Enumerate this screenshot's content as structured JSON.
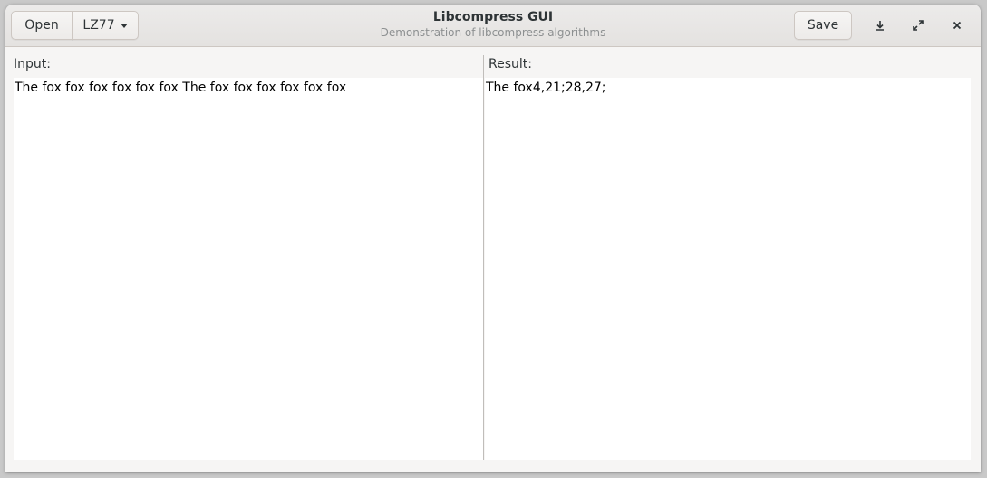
{
  "header": {
    "title": "Libcompress GUI",
    "subtitle": "Demonstration of libcompress algorithms",
    "open_label": "Open",
    "algorithm_selected": "LZ77",
    "save_label": "Save"
  },
  "window_controls": {
    "minimize_icon": "download-arrow-icon",
    "maximize_icon": "expand-icon",
    "close_icon": "close-icon"
  },
  "input_pane": {
    "label": "Input:",
    "text": "The fox fox fox fox fox fox The fox fox fox fox fox fox"
  },
  "result_pane": {
    "label": "Result:",
    "text": "The fox4,21;28,27;"
  },
  "colors": {
    "headerbar": "#e8e6e4",
    "window_bg": "#f6f5f4",
    "text": "#2e3436",
    "subtitle": "#8d9091"
  }
}
